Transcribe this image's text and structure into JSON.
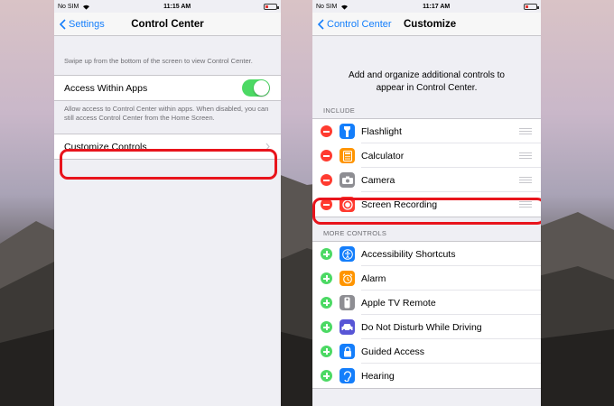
{
  "colors": {
    "accent": "#147efb",
    "toggle_on": "#4cd964",
    "remove": "#ff3b30",
    "highlight": "#e8141c"
  },
  "left_screen": {
    "status": {
      "carrier": "No SIM",
      "time": "11:15 AM"
    },
    "nav": {
      "back_label": "Settings",
      "title": "Control Center"
    },
    "description": "Swipe up from the bottom of the screen to view Control Center.",
    "access_within_apps": {
      "label": "Access Within Apps",
      "enabled": true
    },
    "access_footer": "Allow access to Control Center within apps. When disabled, you can still access Control Center from the Home Screen.",
    "customize_label": "Customize Controls"
  },
  "right_screen": {
    "status": {
      "carrier": "No SIM",
      "time": "11:17 AM"
    },
    "nav": {
      "back_label": "Control Center",
      "title": "Customize"
    },
    "intro": "Add and organize additional controls to appear in Control Center.",
    "include_header": "INCLUDE",
    "included": [
      {
        "label": "Flashlight",
        "icon": "flashlight-icon",
        "color": "#147efb"
      },
      {
        "label": "Calculator",
        "icon": "calculator-icon",
        "color": "#ff9500"
      },
      {
        "label": "Camera",
        "icon": "camera-icon",
        "color": "#8e8e93"
      },
      {
        "label": "Screen Recording",
        "icon": "screen-recording-icon",
        "color": "#ff3b30"
      }
    ],
    "more_header": "MORE CONTROLS",
    "more": [
      {
        "label": "Accessibility Shortcuts",
        "icon": "accessibility-icon",
        "color": "#147efb"
      },
      {
        "label": "Alarm",
        "icon": "alarm-icon",
        "color": "#ff9500"
      },
      {
        "label": "Apple TV Remote",
        "icon": "remote-icon",
        "color": "#8e8e93"
      },
      {
        "label": "Do Not Disturb While Driving",
        "icon": "car-icon",
        "color": "#5856d6"
      },
      {
        "label": "Guided Access",
        "icon": "lock-icon",
        "color": "#147efb"
      },
      {
        "label": "Hearing",
        "icon": "ear-icon",
        "color": "#147efb"
      }
    ]
  }
}
